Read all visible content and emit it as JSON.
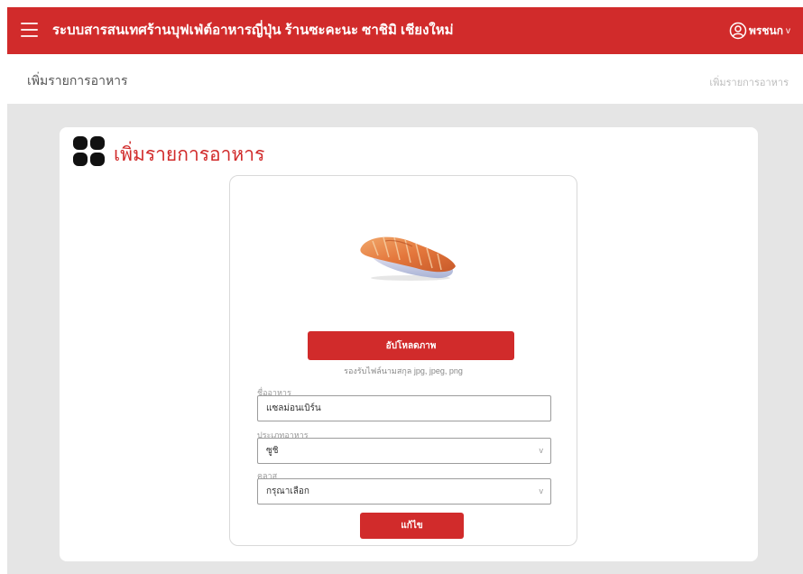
{
  "topbar": {
    "title": "ระบบสารสนเทศร้านบุฟเฟ่ต์อาหารญี่ปุ่น ร้านซะคะนะ ซาชิมิ เชียงใหม่",
    "user_name": "พรชนก",
    "user_chevron": "v",
    "color": "#d12b2b"
  },
  "subheader": {
    "title": "เพิ่มรายการอาหาร",
    "breadcrumb": "เพิ่มรายการอาหาร"
  },
  "card": {
    "title": "เพิ่มรายการอาหาร"
  },
  "form": {
    "upload_button": "อัปโหลดภาพ",
    "upload_hint": "รองรับไฟล์นามสกุล jpg, jpeg, png",
    "name_label": "ชื่ออาหาร",
    "name_value": "แซลม่อนเบิร์น",
    "type_label": "ประเภทอาหาร",
    "type_value": "ซูชิ",
    "class_label": "คลาส",
    "class_value": "กรุณาเลือก",
    "select_caret": "v",
    "submit_button": "แก้ไข"
  },
  "icons": {
    "menu": "hamburger-menu-icon",
    "user": "user-circle-icon",
    "grid": "grid-icon",
    "food": "salmon-sushi-image"
  }
}
